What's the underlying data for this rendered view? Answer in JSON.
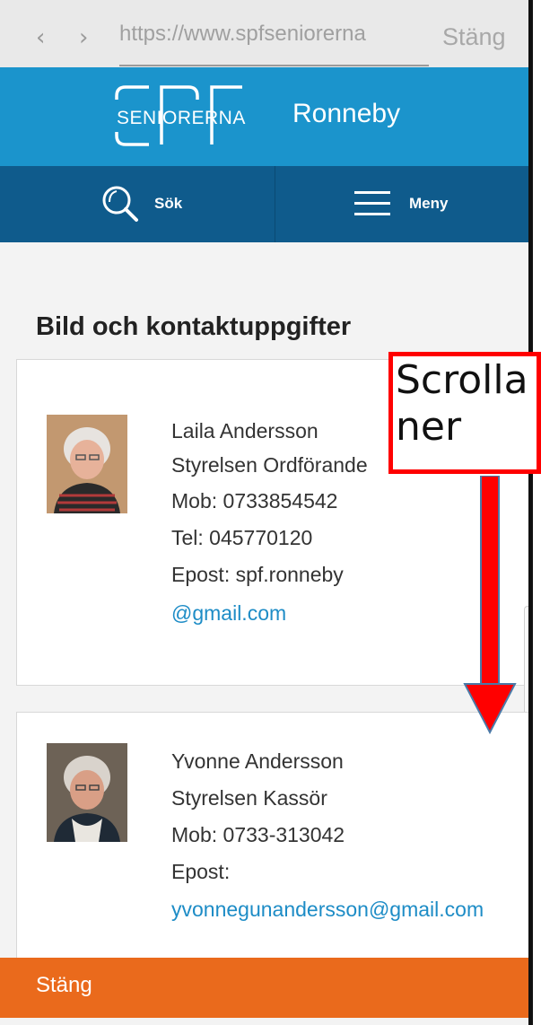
{
  "browser": {
    "back_glyph": "‹",
    "forward_glyph": "›",
    "url": "https://www.spfseniorerna",
    "close_label": "Stäng"
  },
  "header": {
    "logo_text": "SENIORERNA",
    "logo_brand": "SPF",
    "site_name": "Ronneby",
    "brand_color": "#1b94cc"
  },
  "nav": {
    "search_label": "Sök",
    "search_icon": "search-icon",
    "menu_label": "Meny",
    "menu_icon": "hamburger-menu-icon",
    "bar_color": "#0f5b8c"
  },
  "page": {
    "heading": "Bild och kontaktuppgifter"
  },
  "contacts": [
    {
      "name": "Laila Andersson",
      "role": "Styrelsen Ordförande",
      "mobile": "Mob: 0733854542",
      "phone": "Tel: 045770120",
      "email_prefix": "Epost: spf.ronneby",
      "email_link": "@gmail.com"
    },
    {
      "name": "Yvonne Andersson",
      "role": "Styrelsen Kassör",
      "mobile": "Mob: 0733-313042",
      "email_prefix": "Epost:",
      "email_link": "yvonnegunandersson@gmail.com"
    }
  ],
  "footer": {
    "close_label": "Stäng",
    "close_color": "#ea6a1c"
  },
  "annotation": {
    "text": "Scrolla\nner",
    "border_color": "#ff0000",
    "arrow_color": "#ff0000",
    "arrow_direction": "down"
  }
}
